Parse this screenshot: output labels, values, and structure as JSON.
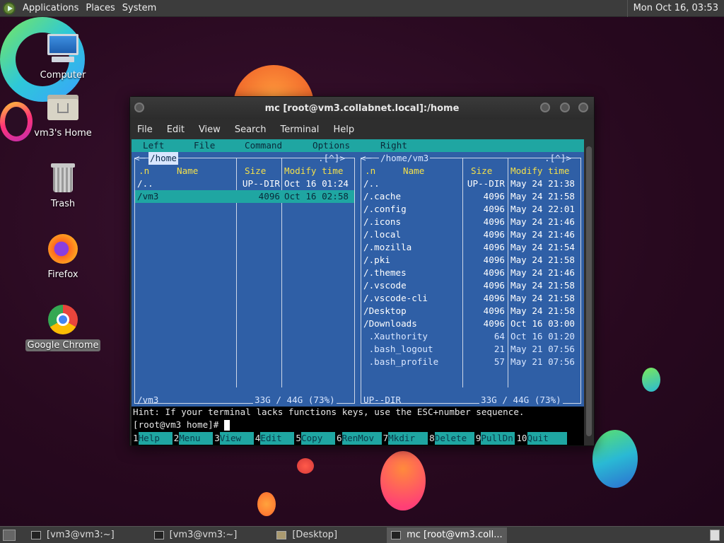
{
  "top_panel": {
    "menus": [
      "Applications",
      "Places",
      "System"
    ],
    "clock": "Mon Oct 16, 03:53"
  },
  "desktop_icons": [
    {
      "label": "Computer",
      "icon": "computer-icon"
    },
    {
      "label": "vm3's Home",
      "icon": "home-folder-icon"
    },
    {
      "label": "Trash",
      "icon": "trash-icon"
    },
    {
      "label": "Firefox",
      "icon": "firefox-icon"
    },
    {
      "label": "Google Chrome",
      "icon": "chrome-icon",
      "selected": true
    }
  ],
  "window": {
    "title": "mc [root@vm3.collabnet.local]:/home",
    "menus": [
      "File",
      "Edit",
      "View",
      "Search",
      "Terminal",
      "Help"
    ]
  },
  "mc": {
    "menu": [
      "Left",
      "File",
      "Command",
      "Options",
      "Right"
    ],
    "left_panel": {
      "path": "/home",
      "corner": ".[^]>",
      "headers": {
        "name_prefix": ".n",
        "name": "Name",
        "size": "Size",
        "modify": "Modify time"
      },
      "rows": [
        {
          "name": "/..",
          "size": "UP--DIR",
          "time": "Oct 16 01:24"
        },
        {
          "name": "/vm3",
          "size": "4096",
          "time": "Oct 16 02:58",
          "selected": true
        }
      ],
      "status": "/vm3",
      "disk": "33G / 44G (73%)"
    },
    "right_panel": {
      "path": "/home/vm3",
      "corner": ".[^]>",
      "headers": {
        "name_prefix": ".n",
        "name": "Name",
        "size": "Size",
        "modify": "Modify time"
      },
      "rows": [
        {
          "name": "/..",
          "size": "UP--DIR",
          "time": "May 24 21:38"
        },
        {
          "name": "/.cache",
          "size": "4096",
          "time": "May 24 21:58"
        },
        {
          "name": "/.config",
          "size": "4096",
          "time": "May 24 22:01"
        },
        {
          "name": "/.icons",
          "size": "4096",
          "time": "May 24 21:46"
        },
        {
          "name": "/.local",
          "size": "4096",
          "time": "May 24 21:46"
        },
        {
          "name": "/.mozilla",
          "size": "4096",
          "time": "May 24 21:54"
        },
        {
          "name": "/.pki",
          "size": "4096",
          "time": "May 24 21:58"
        },
        {
          "name": "/.themes",
          "size": "4096",
          "time": "May 24 21:46"
        },
        {
          "name": "/.vscode",
          "size": "4096",
          "time": "May 24 21:58"
        },
        {
          "name": "/.vscode-cli",
          "size": "4096",
          "time": "May 24 21:58"
        },
        {
          "name": "/Desktop",
          "size": "4096",
          "time": "May 24 21:58"
        },
        {
          "name": "/Downloads",
          "size": "4096",
          "time": "Oct 16 03:00"
        },
        {
          "name": " .Xauthority",
          "size": "64",
          "time": "Oct 16 01:20"
        },
        {
          "name": " .bash_logout",
          "size": "21",
          "time": "May 21 07:56"
        },
        {
          "name": " .bash_profile",
          "size": "57",
          "time": "May 21 07:56"
        }
      ],
      "status": "UP--DIR",
      "disk": "33G / 44G (73%)"
    },
    "hint": "Hint: If your terminal lacks functions keys, use the ESC+number sequence.",
    "prompt": "[root@vm3 home]# ",
    "fkeys": [
      {
        "num": "1",
        "label": "Help"
      },
      {
        "num": "2",
        "label": "Menu"
      },
      {
        "num": "3",
        "label": "View"
      },
      {
        "num": "4",
        "label": "Edit"
      },
      {
        "num": "5",
        "label": "Copy"
      },
      {
        "num": "6",
        "label": "RenMov"
      },
      {
        "num": "7",
        "label": "Mkdir"
      },
      {
        "num": "8",
        "label": "Delete"
      },
      {
        "num": "9",
        "label": "PullDn"
      },
      {
        "num": "10",
        "label": "Quit"
      }
    ]
  },
  "taskbar": {
    "tasks": [
      {
        "label": "[vm3@vm3:~]",
        "active": false
      },
      {
        "label": "[vm3@vm3:~]",
        "active": false
      },
      {
        "label": "[Desktop]",
        "active": false
      },
      {
        "label": "mc [root@vm3.coll...",
        "active": true
      }
    ]
  },
  "colors": {
    "mc_panel": "#2f5fa6",
    "mc_accent": "#1fa6a2",
    "mc_header": "#f4e04a"
  }
}
